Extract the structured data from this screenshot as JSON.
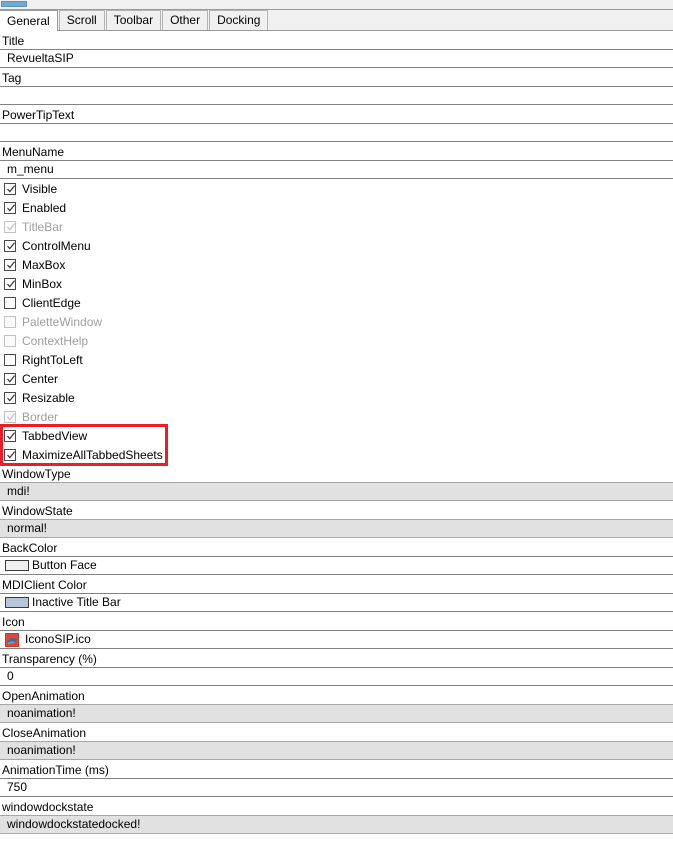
{
  "window": {
    "scrollbar": {
      "name": "horizontal-scrollbar",
      "thumb_position": "left"
    }
  },
  "tabs": [
    {
      "label": "General",
      "active": true
    },
    {
      "label": "Scroll",
      "active": false
    },
    {
      "label": "Toolbar",
      "active": false
    },
    {
      "label": "Other",
      "active": false
    },
    {
      "label": "Docking",
      "active": false
    }
  ],
  "properties": {
    "title": {
      "label": "Title",
      "value": "RevueltaSIP"
    },
    "tag": {
      "label": "Tag",
      "value": ""
    },
    "powertiptext": {
      "label": "PowerTipText",
      "value": ""
    },
    "menuname": {
      "label": "MenuName",
      "value": "m_menu"
    },
    "windowtype": {
      "label": "WindowType",
      "value": "mdi!"
    },
    "windowstate": {
      "label": "WindowState",
      "value": "normal!"
    },
    "backcolor": {
      "label": "BackColor",
      "value": "Button Face",
      "swatch": "#f0f0f0"
    },
    "mdiclientcolor": {
      "label": "MDIClient Color",
      "value": "Inactive Title Bar",
      "swatch": "#b6c6d8"
    },
    "icon": {
      "label": "Icon",
      "value": "IconoSIP.ico",
      "icon_name": "file-ico-icon"
    },
    "transparency": {
      "label": "Transparency (%)",
      "value": "0"
    },
    "openanimation": {
      "label": "OpenAnimation",
      "value": "noanimation!"
    },
    "closeanimation": {
      "label": "CloseAnimation",
      "value": "noanimation!"
    },
    "animationtime": {
      "label": "AnimationTime (ms)",
      "value": "750"
    },
    "windowdockstate": {
      "label": "windowdockstate",
      "value": "windowdockstatedocked!"
    }
  },
  "checkboxes": [
    {
      "label": "Visible",
      "checked": true,
      "enabled": true
    },
    {
      "label": "Enabled",
      "checked": true,
      "enabled": true
    },
    {
      "label": "TitleBar",
      "checked": true,
      "enabled": false
    },
    {
      "label": "ControlMenu",
      "checked": true,
      "enabled": true
    },
    {
      "label": "MaxBox",
      "checked": true,
      "enabled": true
    },
    {
      "label": "MinBox",
      "checked": true,
      "enabled": true
    },
    {
      "label": "ClientEdge",
      "checked": false,
      "enabled": true
    },
    {
      "label": "PaletteWindow",
      "checked": false,
      "enabled": false
    },
    {
      "label": "ContextHelp",
      "checked": false,
      "enabled": false
    },
    {
      "label": "RightToLeft",
      "checked": false,
      "enabled": true
    },
    {
      "label": "Center",
      "checked": true,
      "enabled": true
    },
    {
      "label": "Resizable",
      "checked": true,
      "enabled": true
    },
    {
      "label": "Border",
      "checked": true,
      "enabled": false
    },
    {
      "label": "TabbedView",
      "checked": true,
      "enabled": true
    },
    {
      "label": "MaximizeAllTabbedSheets",
      "checked": true,
      "enabled": true
    }
  ],
  "annotation": {
    "highlight_color": "#ee1c25",
    "highlights": "TabbedView, MaximizeAllTabbedSheets"
  }
}
